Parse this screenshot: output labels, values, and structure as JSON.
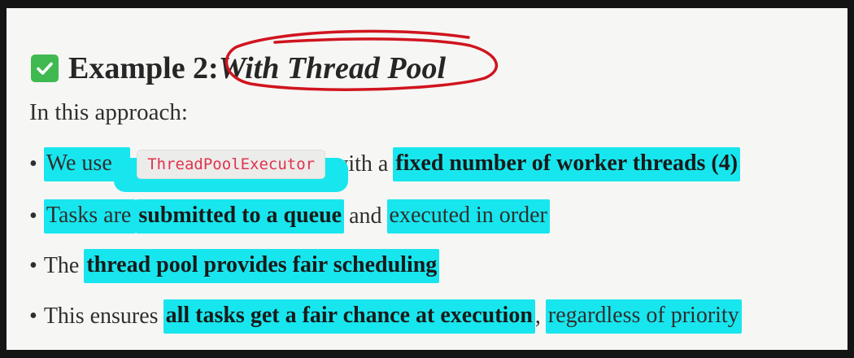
{
  "heading": {
    "check_icon": "check-mark-icon",
    "prefix": "Example 2: ",
    "emphasis": "With Thread Pool"
  },
  "intro": "In this approach:",
  "colors": {
    "highlight": "#18e6ee",
    "circle": "#d0141e",
    "check": "#3fb950",
    "code_text": "#e0334e"
  },
  "bullets": [
    {
      "marker": "•",
      "t1": "We use a",
      "code": "ThreadPoolExecutor",
      "t2": "with a",
      "t3": "fixed number of worker threads (4)"
    },
    {
      "marker": "•",
      "t1": "Tasks are",
      "t2": "submitted to a queue",
      "t3": "and",
      "t4": "executed in order"
    },
    {
      "marker": "•",
      "t1": "The",
      "t2": "thread pool provides fair scheduling"
    },
    {
      "marker": "•",
      "t1": "This ensures",
      "t2": "all tasks get a fair chance at execution",
      "t3": ",",
      "t4": "regardless of priority"
    }
  ]
}
